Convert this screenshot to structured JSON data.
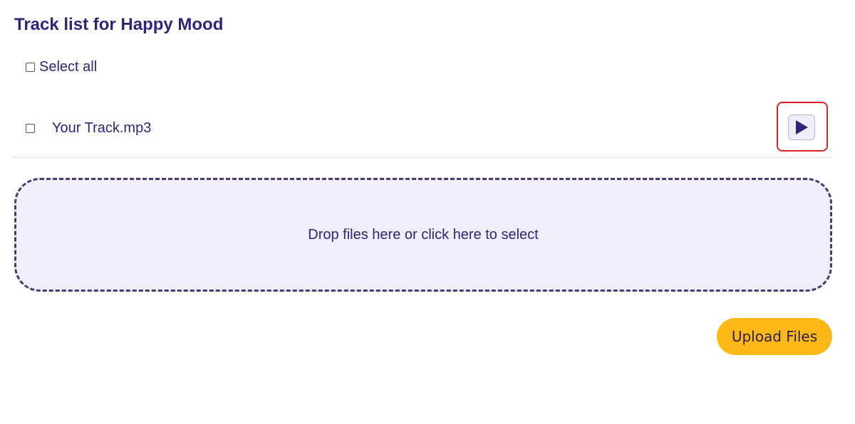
{
  "page": {
    "title": "Track list for Happy Mood"
  },
  "select_all": {
    "label": "Select all",
    "checked": false
  },
  "tracks": [
    {
      "name": "Your Track.mp3",
      "checked": false,
      "play_icon": "play-icon"
    }
  ],
  "dropzone": {
    "text": "Drop files here or click here to select"
  },
  "upload": {
    "label": "Upload Files"
  },
  "colors": {
    "text": "#32237a",
    "dropzone_bg": "#f0eefb",
    "dropzone_border": "#473a70",
    "upload_button": "#fbb816",
    "highlight": "#e0202a"
  }
}
